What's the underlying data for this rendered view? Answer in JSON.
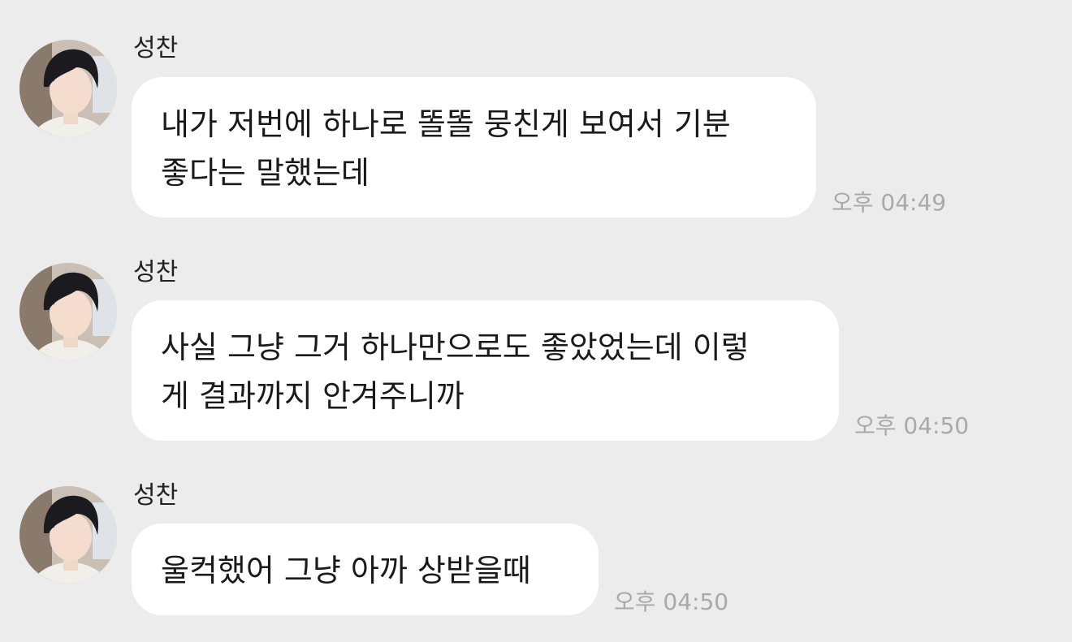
{
  "messages": [
    {
      "sender": "성찬",
      "text": "내가 저번에 하나로 똘똘 뭉친게 보여서 기분\n좋다는 말했는데",
      "time": "오후 04:49"
    },
    {
      "sender": "성찬",
      "text": "사실 그냥 그거 하나만으로도 좋았었는데 이렇\n게 결과까지 안겨주니까",
      "time": "오후 04:50"
    },
    {
      "sender": "성찬",
      "text": "울컥했어 그냥 아까 상받을때",
      "time": "오후 04:50"
    }
  ]
}
